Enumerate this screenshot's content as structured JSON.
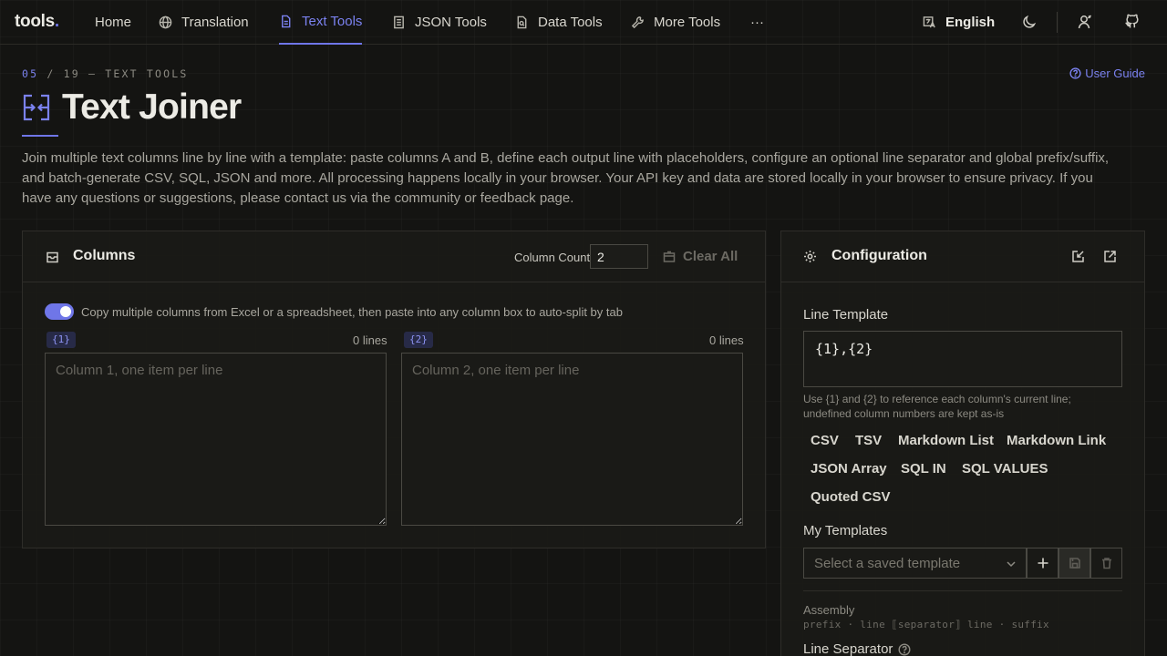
{
  "nav": {
    "logo": "tools",
    "logo_dot": ".",
    "items": [
      {
        "label": "Home"
      },
      {
        "label": "Translation"
      },
      {
        "label": "Text Tools"
      },
      {
        "label": "JSON Tools"
      },
      {
        "label": "Data Tools"
      },
      {
        "label": "More Tools"
      },
      {
        "label": "···"
      }
    ],
    "active": "Text Tools",
    "language": "English"
  },
  "header": {
    "crumb_num": "05",
    "crumb_rest": " / 19 — TEXT TOOLS",
    "user_guide": "User Guide",
    "title": "Text Joiner",
    "description": "Join multiple text columns line by line with a template: paste columns A and B, define each output line with placeholders, configure an optional line separator and global prefix/suffix, and batch-generate CSV, SQL, JSON and more. All processing happens locally in your browser. Your API key and data are stored locally in your browser to ensure privacy. If you have any questions or suggestions, please contact us via the community or feedback page."
  },
  "columns_panel": {
    "title": "Columns",
    "column_count_label": "Column Count",
    "column_count_value": "2",
    "clear_all": "Clear All",
    "toggle_text": "Copy multiple columns from Excel or a spreadsheet, then paste into any column box to auto-split by tab",
    "toggle_on": true,
    "columns": [
      {
        "tag": "{1}",
        "count": "0 lines",
        "placeholder": "Column 1, one item per line"
      },
      {
        "tag": "{2}",
        "count": "0 lines",
        "placeholder": "Column 2, one item per line"
      }
    ]
  },
  "config_panel": {
    "title": "Configuration",
    "line_template_label": "Line Template",
    "line_template_value": "{1},{2}",
    "hint": "Use {1} and {2} to reference each column's current line; undefined column numbers are kept as-is",
    "presets": [
      "CSV",
      "TSV",
      "Markdown List",
      "Markdown Link",
      "JSON Array",
      "SQL IN",
      "SQL VALUES",
      "Quoted CSV"
    ],
    "my_templates_label": "My Templates",
    "select_placeholder": "Select a saved template",
    "assembly_label": "Assembly",
    "assembly_formula": "prefix · line ⟦separator⟧ line · suffix",
    "line_separator_label": "Line Separator"
  },
  "colors": {
    "accent": "#6f76e8",
    "background": "#141412",
    "panel": "#1a1a17"
  }
}
